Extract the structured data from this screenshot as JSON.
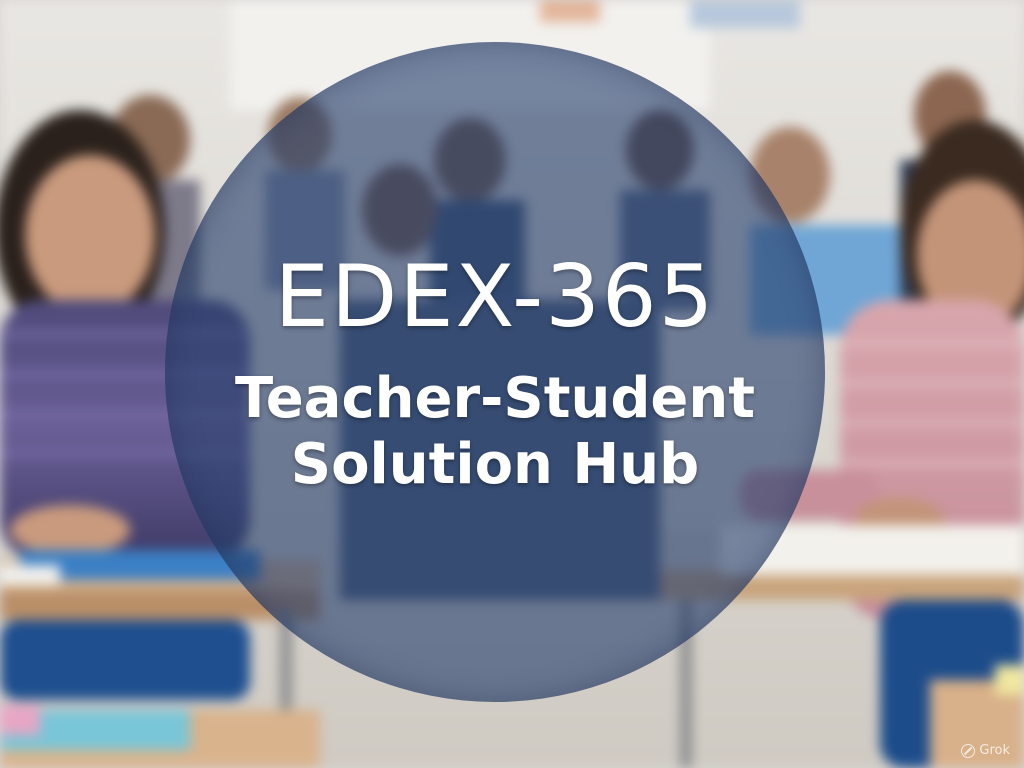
{
  "hero": {
    "title": "EDEX-365",
    "subtitle_line1": "Teacher-Student",
    "subtitle_line2": "Solution Hub"
  },
  "watermark": {
    "icon": "grok-icon",
    "text": "Grok"
  },
  "colors": {
    "overlay": "#28406e",
    "text": "#ffffff",
    "desk": "#d9b38c",
    "chair": "#1f4f8f"
  }
}
